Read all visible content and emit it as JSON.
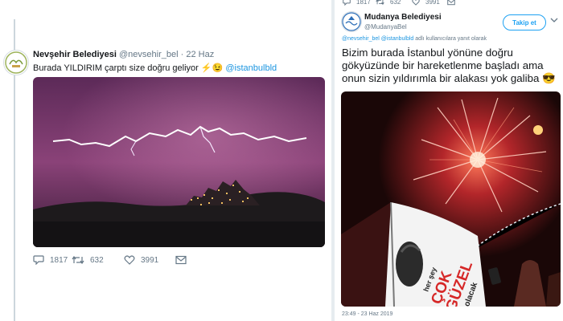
{
  "left_tweet": {
    "display_name": "Nevşehir Belediyesi",
    "handle": "@nevsehir_bel",
    "separator": "·",
    "date": "22 Haz",
    "text": "Burada YILDIRIM çarptı size doğru geliyor",
    "emoji": "⚡😉",
    "mention": "@istanbulbld",
    "actions": {
      "replies": "1817",
      "retweets": "632",
      "likes": "3991"
    }
  },
  "right_tweet": {
    "top_counts": {
      "replies": "1817",
      "retweets": "632",
      "likes": "3991"
    },
    "display_name": "Mudanya Belediyesi",
    "handle": "@MudanyaBel",
    "follow_label": "Takip et",
    "reply_to_mentions": "@nevsehir_bel @istanbulbld",
    "reply_to_suffix": "adlı kullanıcılara yanıt olarak",
    "body_lines": [
      "Bizim burada İstanbul yönüne doğru",
      "gökyüzünde bir hareketlenme başladı ama",
      "onun sizin yıldırımla bir alakası yok galiba"
    ],
    "body_emoji": "😎",
    "timestamp": "23:49 - 23 Haz 2019"
  },
  "flag_text": [
    "her şey",
    "ÇOK",
    "GÜZEL",
    "olacak"
  ],
  "colors": {
    "link": "#1b95e0",
    "follow": "#1da1f2",
    "muted": "#657786",
    "sky": "#7a3a6b"
  }
}
